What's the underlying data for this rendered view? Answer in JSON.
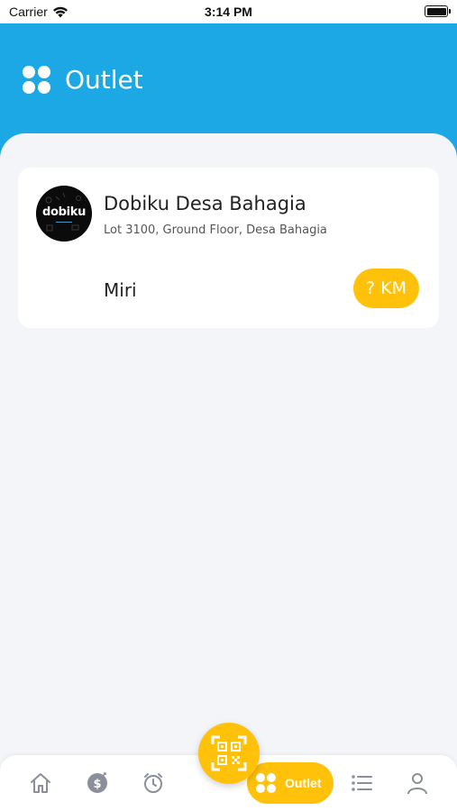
{
  "status_bar": {
    "carrier": "Carrier",
    "time": "3:14 PM"
  },
  "header": {
    "title": "Outlet",
    "icon": "grid-icon"
  },
  "outlets": [
    {
      "name": "Dobiku Desa Bahagia",
      "address": "Lot 3100, Ground Floor, Desa Bahagia",
      "city": "Miri",
      "distance": "? KM",
      "logo_text": "dobiku"
    }
  ],
  "bottom_nav": {
    "items": [
      {
        "icon": "home-icon"
      },
      {
        "icon": "money-icon"
      },
      {
        "icon": "alarm-clock-icon"
      },
      {
        "icon": "grid-icon",
        "label": "Outlet",
        "active": true
      },
      {
        "icon": "list-icon"
      },
      {
        "icon": "user-icon"
      }
    ],
    "fab_icon": "qr-scan-icon"
  },
  "colors": {
    "header_blue": "#1BA8E4",
    "accent_yellow": "#FFC10A",
    "background": "#F3F5F9"
  }
}
